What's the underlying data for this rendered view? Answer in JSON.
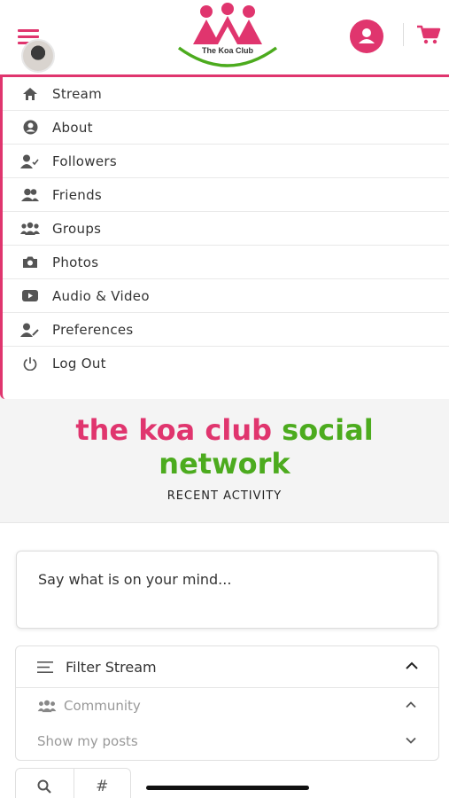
{
  "header": {
    "logo_text": "The Koa Club",
    "brand_color": "#e0356e",
    "accent_color": "#4cab1e",
    "icons": [
      "hamburger-icon",
      "user-avatar",
      "profile-icon",
      "cart-icon"
    ]
  },
  "menu": {
    "items": [
      {
        "label": "Stream",
        "icon": "home-icon"
      },
      {
        "label": "About",
        "icon": "user-circle-icon"
      },
      {
        "label": "Followers",
        "icon": "user-check-icon"
      },
      {
        "label": "Friends",
        "icon": "friends-icon"
      },
      {
        "label": "Groups",
        "icon": "groups-icon"
      },
      {
        "label": "Photos",
        "icon": "camera-icon"
      },
      {
        "label": "Audio & Video",
        "icon": "video-icon"
      },
      {
        "label": "Preferences",
        "icon": "user-edit-icon"
      },
      {
        "label": "Log Out",
        "icon": "power-icon"
      }
    ]
  },
  "hero": {
    "title_part1": "the koa club ",
    "title_part2": "social",
    "title_part3": "network",
    "subtitle": "RECENT ACTIVITY"
  },
  "post": {
    "placeholder": "Say what is on your mind..."
  },
  "filter": {
    "title": "Filter Stream",
    "community_label": "Community",
    "show_label": "Show my posts"
  },
  "tabs": {
    "hash_label": "#"
  }
}
